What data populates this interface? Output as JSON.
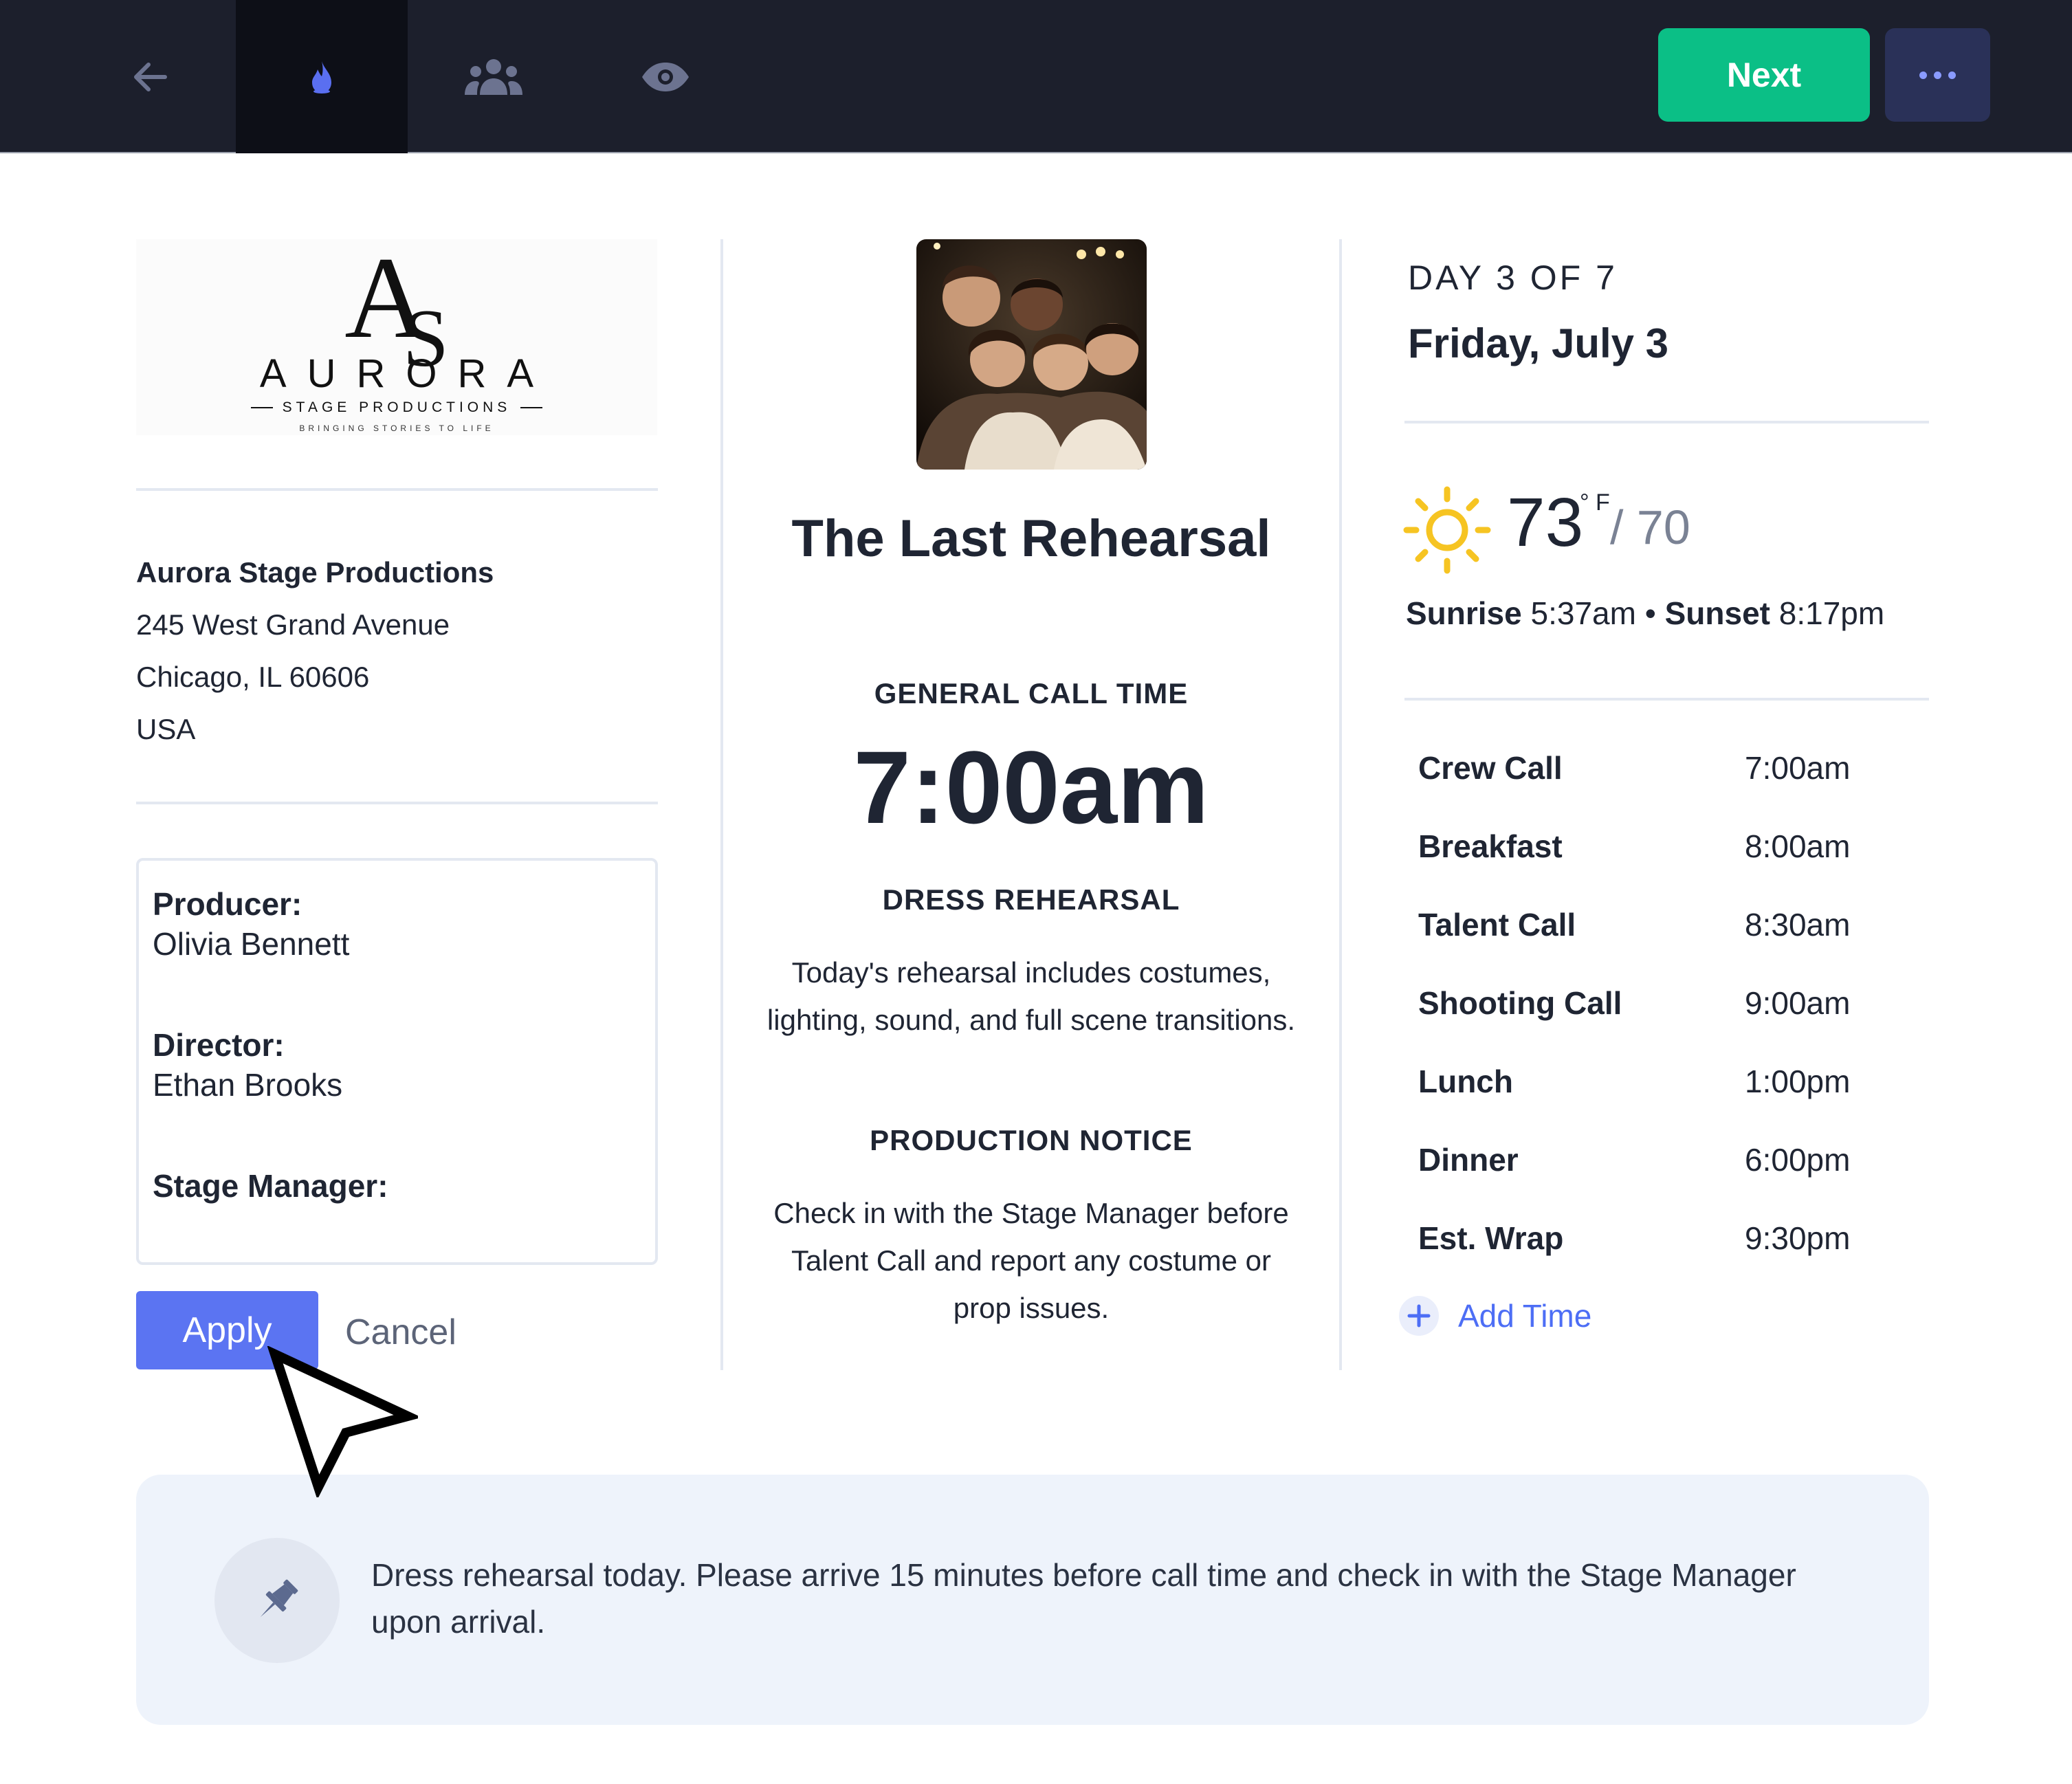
{
  "toolbar": {
    "items": [
      {
        "name": "back",
        "icon": "arrow-left-icon",
        "active": false
      },
      {
        "name": "fire",
        "icon": "flame-icon",
        "active": true
      },
      {
        "name": "people",
        "icon": "users-icon",
        "active": false
      },
      {
        "name": "preview",
        "icon": "eye-icon",
        "active": false
      }
    ],
    "next_label": "Next",
    "more_icon": "more-horizontal-icon"
  },
  "company": {
    "logo": {
      "monogram": "AS",
      "name": "AURORA",
      "subtitle": "STAGE PRODUCTIONS",
      "tagline": "BRINGING STORIES TO LIFE"
    },
    "name": "Aurora Stage Productions",
    "street": "245 West Grand Avenue",
    "city": "Chicago, IL 60606",
    "country": "USA"
  },
  "crew": {
    "producer_label": "Producer:",
    "producer_value": "Olivia Bennett",
    "director_label": "Director:",
    "director_value": "Ethan Brooks",
    "stage_manager_label": "Stage Manager:",
    "stage_manager_value": ""
  },
  "actions": {
    "apply_label": "Apply",
    "cancel_label": "Cancel"
  },
  "production": {
    "title": "The Last Rehearsal",
    "call_heading": "GENERAL CALL TIME",
    "call_time": "7:00am",
    "rehearsal_heading": "DRESS REHEARSAL",
    "rehearsal_text": "Today's rehearsal includes costumes, lighting, sound, and full scene transitions.",
    "notice_heading": "PRODUCTION NOTICE",
    "notice_text": "Check in with the Stage Manager before Talent Call and report any costume or prop issues."
  },
  "day": {
    "label": "DAY 3 OF 7",
    "date": "Friday, July 3"
  },
  "weather": {
    "icon": "sun-icon",
    "high": "73",
    "unit": "° F",
    "low": "/ 70",
    "sunrise_label": "Sunrise",
    "sunrise": "5:37am",
    "separator": "•",
    "sunset_label": "Sunset",
    "sunset": "8:17pm"
  },
  "schedule": [
    {
      "label": "Crew Call",
      "time": "7:00am"
    },
    {
      "label": "Breakfast",
      "time": "8:00am"
    },
    {
      "label": "Talent Call",
      "time": "8:30am"
    },
    {
      "label": "Shooting Call",
      "time": "9:00am"
    },
    {
      "label": "Lunch",
      "time": "1:00pm"
    },
    {
      "label": "Dinner",
      "time": "6:00pm"
    },
    {
      "label": "Est. Wrap",
      "time": "9:30pm"
    }
  ],
  "add_time_label": "Add Time",
  "notice": {
    "icon": "pin-icon",
    "text": "Dress rehearsal today. Please arrive 15 minutes before call time and check in with the Stage Manager upon arrival."
  },
  "colors": {
    "topbar": "#1c1f2c",
    "next_button": "#0bbf86",
    "apply_button": "#5b74f2",
    "link": "#4d6ef5",
    "notice_bg": "#eef3fb"
  }
}
